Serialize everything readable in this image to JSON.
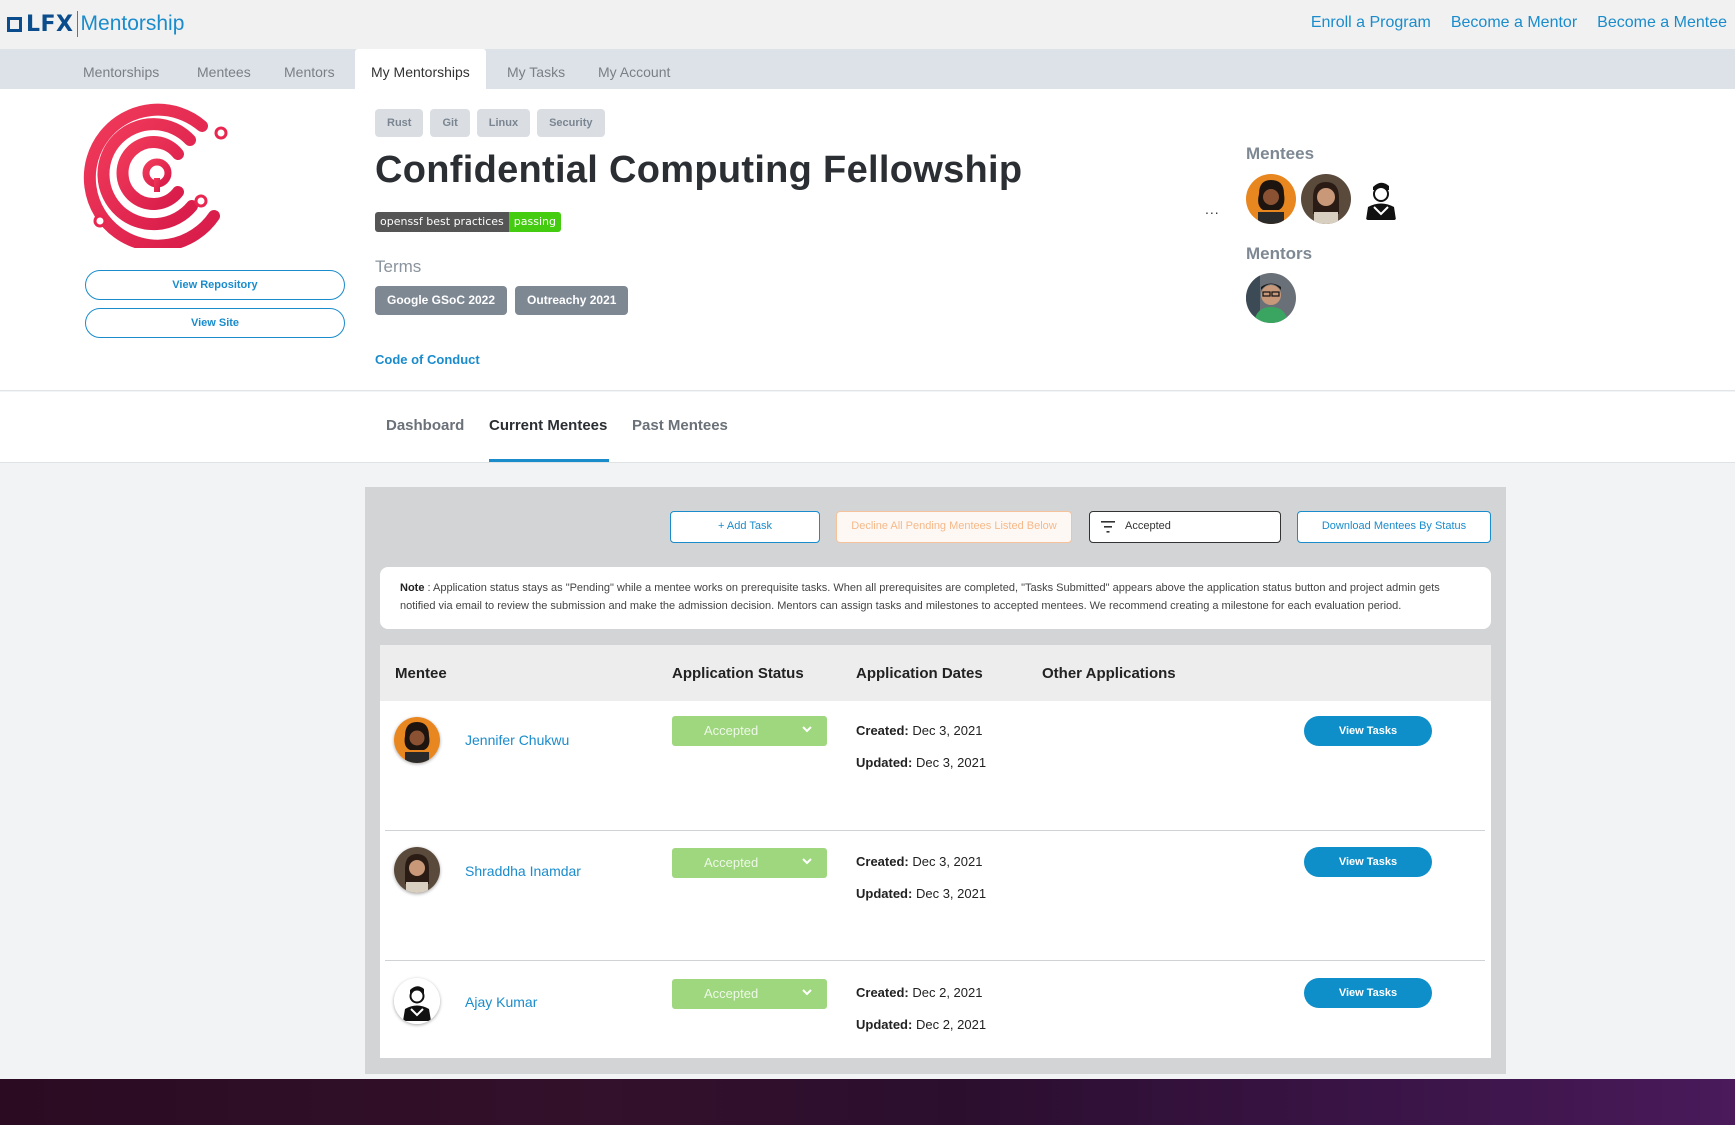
{
  "brand": {
    "lfx": "LFX",
    "product": "Mentorship"
  },
  "top_links": [
    "Enroll a Program",
    "Become a Mentor",
    "Become a Mentee"
  ],
  "nav_tabs": [
    "Mentorships",
    "Mentees",
    "Mentors",
    "My Mentorships",
    "My Tasks",
    "My Account"
  ],
  "nav_active": "My Mentorships",
  "project": {
    "tags": [
      "Rust",
      "Git",
      "Linux",
      "Security"
    ],
    "title": "Confidential Computing Fellowship",
    "badge_left": "openssf best practices",
    "badge_right": "passing",
    "terms_label": "Terms",
    "terms": [
      "Google GSoC 2022",
      "Outreachy 2021"
    ],
    "code_of_conduct": "Code of Conduct",
    "view_repository": "View Repository",
    "view_site": "View Site",
    "more": "...",
    "logo_color": "#e8264f"
  },
  "side": {
    "mentees_label": "Mentees",
    "mentors_label": "Mentors"
  },
  "sub_tabs": [
    "Dashboard",
    "Current Mentees",
    "Past Mentees"
  ],
  "sub_tab_active": "Current Mentees",
  "toolbar": {
    "add_task": "+ Add Task",
    "decline_all": "Decline All Pending Mentees Listed Below",
    "filter_value": "Accepted",
    "download": "Download Mentees By Status"
  },
  "note": {
    "label": "Note",
    "text": " : Application status stays as \"Pending\" while a mentee works on prerequisite tasks. When all prerequisites are completed, \"Tasks Submitted\" appears above the application status button and project admin gets notified via email to review the submission and make the admission decision. Mentors can assign tasks and milestones to accepted mentees. We recommend creating a milestone for each evaluation period."
  },
  "table": {
    "headers": [
      "Mentee",
      "Application Status",
      "Application Dates",
      "Other Applications"
    ],
    "created_label": "Created:",
    "updated_label": "Updated:",
    "view_tasks": "View Tasks",
    "rows": [
      {
        "name": "Jennifer Chukwu",
        "status": "Accepted",
        "created": "Dec 3, 2021",
        "updated": "Dec 3, 2021"
      },
      {
        "name": "Shraddha Inamdar",
        "status": "Accepted",
        "created": "Dec 3, 2021",
        "updated": "Dec 3, 2021"
      },
      {
        "name": "Ajay Kumar",
        "status": "Accepted",
        "created": "Dec 2, 2021",
        "updated": "Dec 2, 2021"
      }
    ]
  },
  "colors": {
    "accent": "#1a8ccc",
    "accepted": "#9ed77d",
    "view_tasks": "#0e8fc9"
  }
}
